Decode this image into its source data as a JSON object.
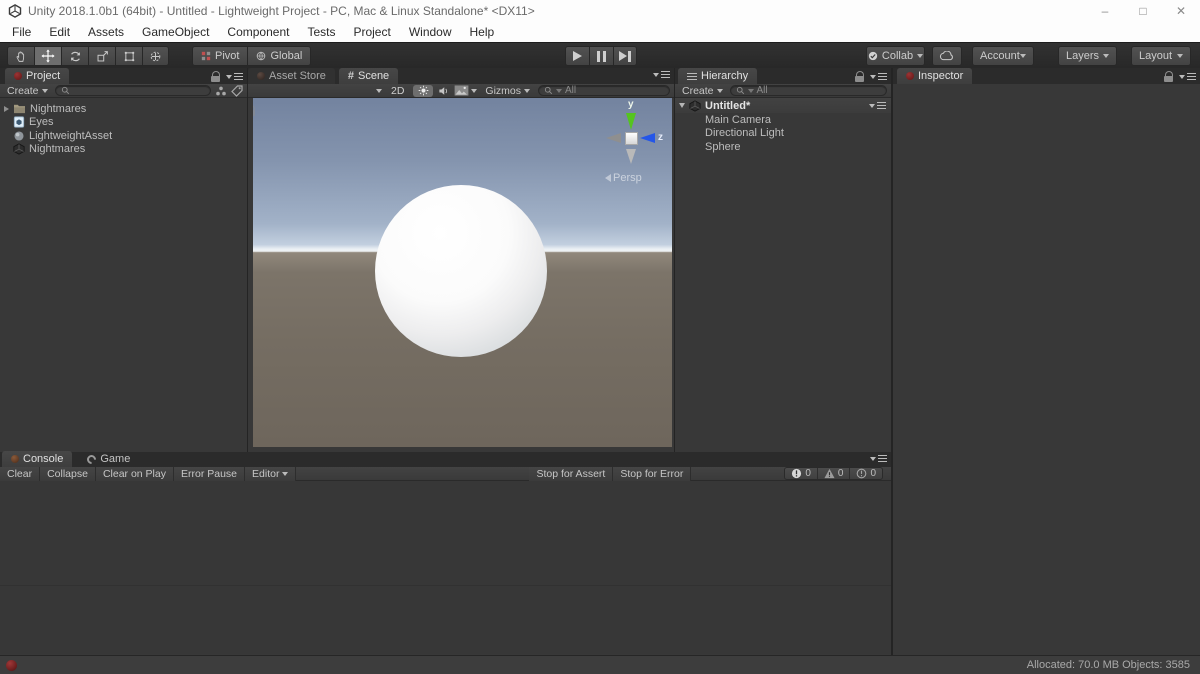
{
  "window": {
    "title": "Unity 2018.1.0b1 (64bit) - Untitled - Lightweight Project - PC, Mac & Linux Standalone* <DX11>",
    "controls": {
      "minimize": "–",
      "maximize": "□",
      "close": "✕"
    }
  },
  "menubar": {
    "items": [
      "File",
      "Edit",
      "Assets",
      "GameObject",
      "Component",
      "Tests",
      "Project",
      "Window",
      "Help"
    ]
  },
  "toolbar": {
    "pivot_label": "Pivot",
    "global_label": "Global",
    "collab_label": "Collab",
    "account_label": "Account",
    "layers_label": "Layers",
    "layout_label": "Layout"
  },
  "project": {
    "tab": "Project",
    "create_label": "Create",
    "items": [
      {
        "label": "Nightmares",
        "type": "folder"
      },
      {
        "label": "Eyes",
        "type": "scene"
      },
      {
        "label": "LightweightAsset",
        "type": "pipeline-asset"
      },
      {
        "label": "Nightmares",
        "type": "prefab"
      }
    ]
  },
  "scene": {
    "tabs": {
      "asset_store": "Asset Store",
      "scene": "Scene"
    },
    "toolbar": {
      "mode_2d": "2D",
      "gizmos_label": "Gizmos",
      "search_text": "All"
    },
    "gizmo": {
      "y_label": "y",
      "z_label": "z",
      "persp_label": "Persp"
    }
  },
  "hierarchy": {
    "tab": "Hierarchy",
    "create_label": "Create",
    "search_text": "All",
    "scene_name": "Untitled*",
    "items": [
      "Main Camera",
      "Directional Light",
      "Sphere"
    ]
  },
  "inspector": {
    "tab": "Inspector"
  },
  "console": {
    "tab": "Console",
    "game_tab": "Game",
    "buttons": [
      "Clear",
      "Collapse",
      "Clear on Play",
      "Error Pause",
      "Editor"
    ],
    "stop_assert": "Stop for Assert",
    "stop_error": "Stop for Error",
    "counts": {
      "errors": "0",
      "warnings": "0",
      "messages": "0"
    }
  },
  "statusbar": {
    "allocated": "Allocated: 70.0 MB Objects: 3585"
  },
  "colors": {
    "axis_y_green": "#55c41f",
    "axis_z_blue": "#2456e8",
    "panel_bg": "#383838",
    "strip_bg": "#2b2b2b",
    "titlebar_bg": "#fdfdfd"
  }
}
